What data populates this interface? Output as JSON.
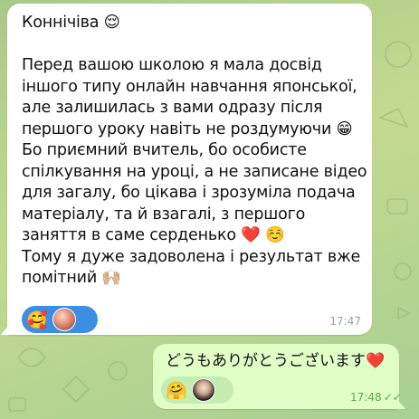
{
  "incoming_message": {
    "text": "Коннічіва 😌\n\nПеред вашою школою я мала досвід іншого типу онлайн навчання японської, але залишилась з вами одразу після першого уроку навіть не роздумуючи 😁\nБо приємний вчитель, бо особисте спілкування на уроці, а не записане відео для загалу, бо цікава і зрозуміла подача матеріалу, та й взагалі, з першого заняття в саме серденько ❤️ ☺️\nТому я дуже задоволена і результат вже помітний 🙌🏼",
    "reaction_emoji": "🥰",
    "time": "17:47"
  },
  "outgoing_message": {
    "text": "どうもありがとうございます❤️",
    "reaction_emoji": "🤗",
    "time": "17:48",
    "read_status": "✓✓"
  },
  "colors": {
    "incoming_bg": "#ffffff",
    "outgoing_bg": "#e1fec6",
    "incoming_reaction_bg": "#3d8ee3",
    "outgoing_reaction_bg": "#c5edb0"
  }
}
